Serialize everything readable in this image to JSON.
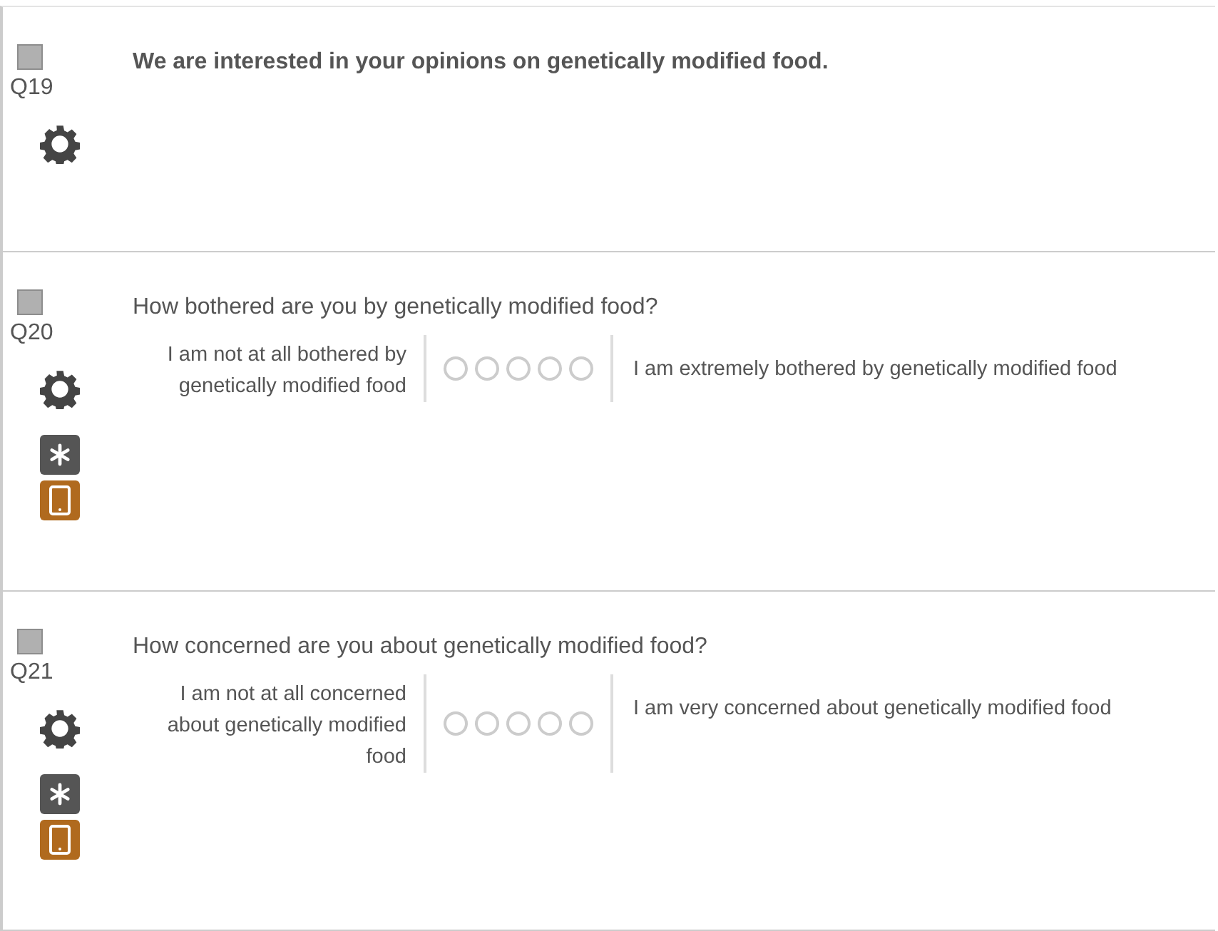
{
  "questions": [
    {
      "number": "Q19",
      "kind": "text",
      "checked": false,
      "required": false,
      "mobile": false,
      "text": "We are interested in your opinions on genetically modified food."
    },
    {
      "number": "Q20",
      "kind": "scale",
      "checked": false,
      "required": true,
      "mobile": true,
      "text": "How bothered are you by genetically modified food?",
      "left_label": "I am not at all bothered by genetically modified food",
      "right_label": "I am extremely bothered by genetically modified food",
      "options": [
        {
          "selected": false
        },
        {
          "selected": false
        },
        {
          "selected": false
        },
        {
          "selected": false
        },
        {
          "selected": false
        }
      ]
    },
    {
      "number": "Q21",
      "kind": "scale",
      "checked": false,
      "required": true,
      "mobile": true,
      "text": "How concerned are you about genetically modified food?",
      "left_label": "I am not at all concerned about genetically modified food",
      "right_label": "I am very concerned about genetically modified food",
      "options": [
        {
          "selected": false
        },
        {
          "selected": false
        },
        {
          "selected": false
        },
        {
          "selected": false
        },
        {
          "selected": false
        }
      ]
    }
  ]
}
